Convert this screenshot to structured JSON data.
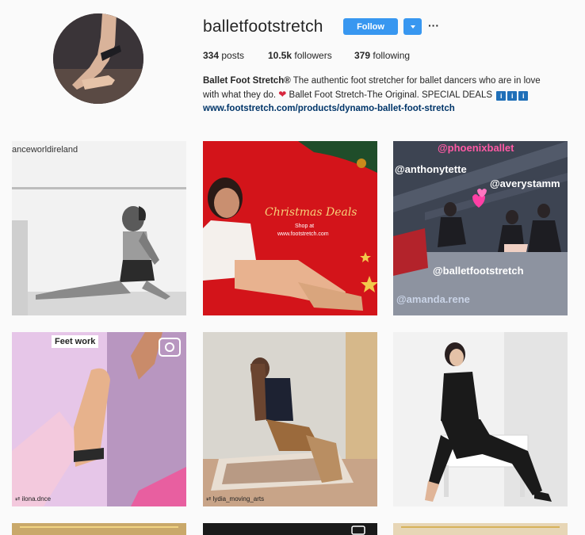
{
  "profile": {
    "username": "balletfootstretch",
    "follow_label": "Follow",
    "more_label": "···",
    "stats": {
      "posts_count": "334",
      "posts_label": "posts",
      "followers_count": "10.5k",
      "followers_label": "followers",
      "following_count": "379",
      "following_label": "following"
    },
    "bio": {
      "name": "Ballet Foot Stretch®",
      "text_1": "The authentic foot stretcher for ballet dancers who are in love with what they do.",
      "text_2": "Ballet Foot Stretch-The Original. SPECIAL DEALS",
      "emoji_i": "i",
      "link": "www.footstretch.com/products/dynamo-ballet-foot-stretch"
    }
  },
  "posts": [
    {
      "overlay": "anceworldireland"
    },
    {
      "overlay_1": "Christmas Deals",
      "overlay_2": "Shop at",
      "overlay_3": "www.footstretch.com"
    },
    {
      "tags": [
        "@phoenixballet",
        "@anthonytette",
        "@averystamm",
        "@balletfootstretch",
        "@amanda.rene"
      ]
    },
    {
      "overlay": "Feet work",
      "credit": "ilona.dnce"
    },
    {
      "credit": "lydia_moving_arts"
    },
    {}
  ],
  "colors": {
    "accent": "#3897f0",
    "link": "#003569",
    "background": "#fafafa"
  }
}
